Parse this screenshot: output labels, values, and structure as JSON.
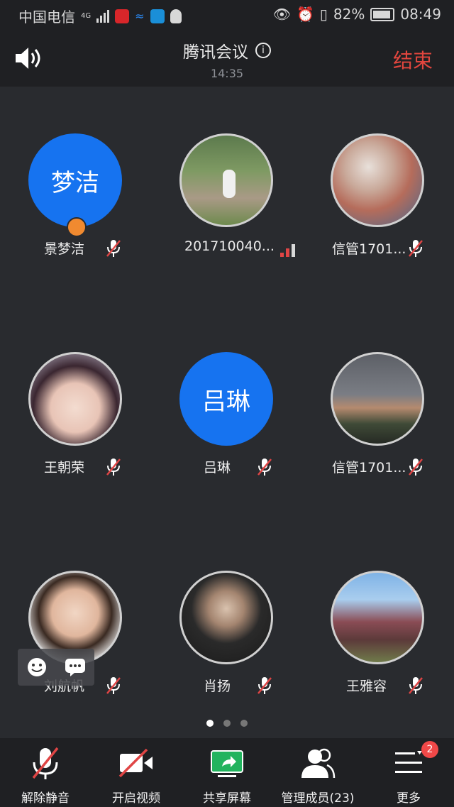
{
  "status_bar": {
    "carrier": "中国电信",
    "network": "4G",
    "battery": "82%",
    "time": "08:49"
  },
  "header": {
    "title": "腾讯会议",
    "duration": "14:35",
    "end_label": "结束",
    "end_color": "#e2463e"
  },
  "participants": [
    {
      "name": "景梦洁",
      "avatar_text": "梦洁",
      "avatar_type": "initials",
      "is_host": true,
      "mic": "muted"
    },
    {
      "name": "201710040...",
      "avatar_type": "photo",
      "mic": "speaking-bars"
    },
    {
      "name": "信管1701...",
      "avatar_type": "photo",
      "mic": "muted"
    },
    {
      "name": "王朝荣",
      "avatar_type": "photo",
      "mic": "muted"
    },
    {
      "name": "吕琳",
      "avatar_text": "吕琳",
      "avatar_type": "initials",
      "mic": "muted"
    },
    {
      "name": "信管1701...",
      "avatar_type": "photo",
      "mic": "muted"
    },
    {
      "name": "刘航帆",
      "avatar_type": "photo",
      "mic": "muted"
    },
    {
      "name": "肖扬",
      "avatar_type": "photo",
      "mic": "muted"
    },
    {
      "name": "王雅容",
      "avatar_type": "photo",
      "mic": "muted"
    }
  ],
  "pager": {
    "current": 1,
    "total": 3
  },
  "toolbar": {
    "unmute": "解除静音",
    "start_video": "开启视频",
    "share_screen": "共享屏幕",
    "manage_members": "管理成员(23)",
    "more": "更多",
    "more_badge": "2",
    "share_color": "#22b35e"
  },
  "colors": {
    "background": "#292b2f",
    "bar": "#1f2023",
    "accent_blue": "#1673f0",
    "muted_red": "#e04545"
  }
}
